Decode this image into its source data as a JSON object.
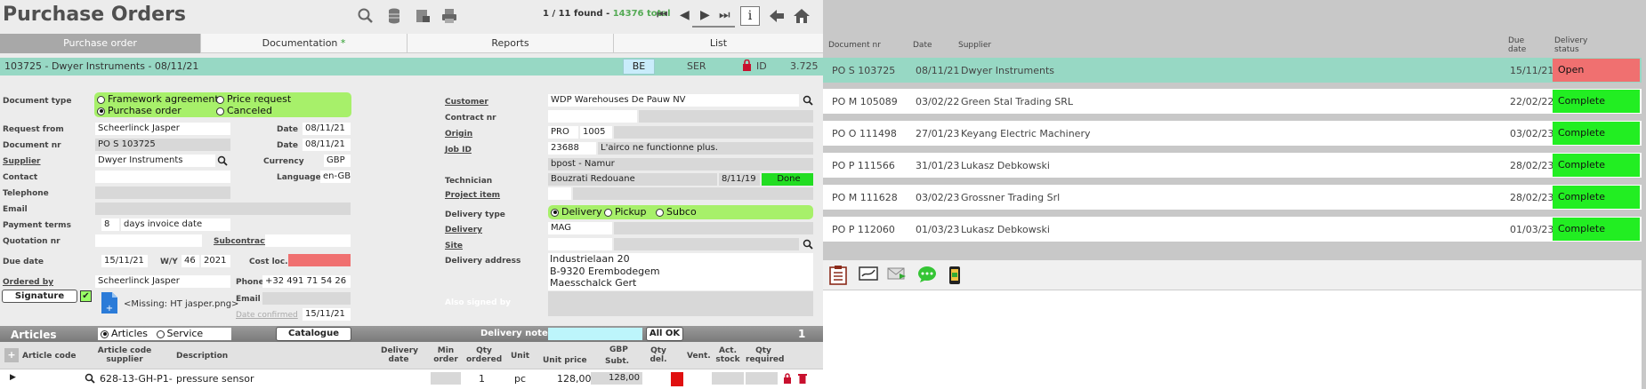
{
  "app": {
    "title": "Purchase Orders",
    "found_text": "1 / 11 found - ",
    "total_text": "14376 total"
  },
  "tabs": [
    {
      "label": "Purchase order",
      "star": ""
    },
    {
      "label": "Documentation",
      "star": " *"
    },
    {
      "label": "Reports",
      "star": ""
    },
    {
      "label": "List",
      "star": ""
    }
  ],
  "record": {
    "title": "103725 - Dwyer Instruments - 08/11/21",
    "country": "BE",
    "ser": "SER",
    "id_label": "ID",
    "id_value": "3.725"
  },
  "form": {
    "document_type_label": "Document type",
    "doc_types": [
      "Framework agreement",
      "Price request",
      "Purchase order",
      "Canceled"
    ],
    "request_from_label": "Request from",
    "request_from": "Scheerlinck Jasper",
    "date_label": "Date",
    "date1": "08/11/21",
    "document_nr_label": "Document nr",
    "document_nr": "PO S 103725",
    "date2": "08/11/21",
    "supplier_label": "Supplier",
    "supplier": "Dwyer Instruments",
    "currency_label": "Currency",
    "currency": "GBP",
    "contact_label": "Contact",
    "language_label": "Language",
    "language": "en-GB",
    "telephone_label": "Telephone",
    "email_label": "Email",
    "payment_terms_label": "Payment terms",
    "payment_days": "8",
    "payment_text": "days invoice date",
    "quotation_label": "Quotation nr",
    "subcontract_label": "Subcontract",
    "due_date_label": "Due date",
    "due_date": "15/11/21",
    "wy_label": "W/Y",
    "week": "46",
    "year": "2021",
    "cost_loc_label": "Cost loc.",
    "ordered_by_label": "Ordered by",
    "ordered_by": "Scheerlinck Jasper",
    "phone_label": "Phone",
    "phone": "+32 491 71 54 26",
    "signature_label": "Signature",
    "email2_label": "Email",
    "missing_file": "<Missing: HT jasper.png>",
    "date_confirmed_label": "Date confirmed",
    "date_confirmed": "15/11/21",
    "customer_label": "Customer",
    "customer": "WDP Warehouses De Pauw NV",
    "contract_nr_label": "Contract nr",
    "origin_label": "Origin",
    "origin_code": "PRO",
    "origin_nr": "1005",
    "job_id_label": "Job ID",
    "job_id": "23688",
    "job_desc": "L'airco ne functionne plus.",
    "job_location": "bpost - Namur",
    "technician_label": "Technician",
    "technician": "Bouzrati Redouane",
    "tech_date": "8/11/19",
    "tech_status": "Done",
    "project_item_label": "Project item",
    "delivery_type_label": "Delivery type",
    "delivery_types": [
      "Delivery",
      "Pickup",
      "Subco"
    ],
    "delivery_label": "Delivery",
    "delivery": "MAG",
    "site_label": "Site",
    "delivery_address_label": "Delivery address",
    "address_lines": [
      "Industrielaan 20",
      "B-9320  Erembodegem",
      "Maesschalck Gert"
    ],
    "also_signed_label": "Also signed by"
  },
  "articles": {
    "title": "Articles",
    "options": [
      "Articles",
      "Service"
    ],
    "catalogue_label": "Catalogue",
    "delivery_note_label": "Delivery note nr",
    "all_ok_label": "All OK",
    "count": "1",
    "headers": {
      "article_code": "Article code",
      "article_code_supplier": "Article code supplier",
      "description": "Description",
      "delivery_date": "Delivery date",
      "min_order": "Min order",
      "qty_ordered": "Qty ordered",
      "unit": "Unit",
      "unit_price": "Unit price",
      "currency": "GBP",
      "subt": "Subt.",
      "qty_del": "Qty del.",
      "vent": "Vent.",
      "act_stock": "Act. stock",
      "qty_required": "Qty required"
    },
    "rows": [
      {
        "code_supplier": "628-13-GH-P1-",
        "description": "pressure sensor",
        "qty_ordered": "1",
        "unit": "pc",
        "unit_price": "128,00",
        "subtotal": "128,00"
      }
    ]
  },
  "list": {
    "headers": {
      "doc_nr": "Document nr",
      "date": "Date",
      "supplier": "Supplier",
      "due_date": "Due date",
      "status": "Delivery status"
    },
    "rows": [
      {
        "doc_nr": "PO S 103725",
        "date": "08/11/21",
        "supplier": "Dwyer Instruments",
        "due_date": "15/11/21",
        "status": "Open"
      },
      {
        "doc_nr": "PO M 105089",
        "date": "03/02/22",
        "supplier": "Green Stal Trading SRL",
        "due_date": "22/02/22",
        "status": "Complete"
      },
      {
        "doc_nr": "PO O 111498",
        "date": "27/01/23",
        "supplier": "Keyang Electric  Machinery",
        "due_date": "03/02/23",
        "status": "Complete"
      },
      {
        "doc_nr": "PO P 111566",
        "date": "31/01/23",
        "supplier": "Lukasz Debkowski",
        "due_date": "28/02/23",
        "status": "Complete"
      },
      {
        "doc_nr": "PO M 111628",
        "date": "03/02/23",
        "supplier": "Grossner Trading Srl",
        "due_date": "28/02/23",
        "status": "Complete"
      },
      {
        "doc_nr": "PO P 112060",
        "date": "01/03/23",
        "supplier": "Lukasz Debkowski",
        "due_date": "01/03/23",
        "status": "Complete"
      }
    ]
  },
  "colors": {
    "record_bar": "#97d8c4",
    "status_open": "#f07070",
    "status_complete": "#22ee22",
    "green_panel": "#a7f06a"
  }
}
